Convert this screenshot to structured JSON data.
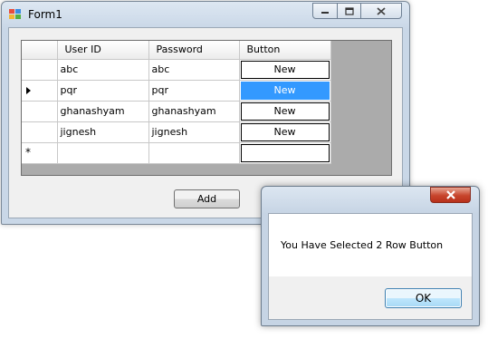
{
  "window": {
    "title": "Form1",
    "add_button": "Add"
  },
  "grid": {
    "columns": [
      "User ID",
      "Password",
      "Button"
    ],
    "rows": [
      {
        "user_id": "abc",
        "password": "abc",
        "button": "New"
      },
      {
        "user_id": "pqr",
        "password": "pqr",
        "button": "New"
      },
      {
        "user_id": "ghanashyam",
        "password": "ghanashyam",
        "button": "New"
      },
      {
        "user_id": "jignesh",
        "password": "jignesh",
        "button": "New"
      }
    ],
    "new_row_marker": "*"
  },
  "message_box": {
    "text": "You Have Selected 2 Row Button",
    "ok_label": "OK"
  },
  "icons": {
    "app": "form-app-icon",
    "minimize": "minimize-icon",
    "maximize": "maximize-icon",
    "close": "close-icon",
    "current_row": "row-pointer-icon"
  },
  "colors": {
    "selection": "#3399ff",
    "grid_background": "#ababab",
    "close_button": "#c7452c"
  }
}
